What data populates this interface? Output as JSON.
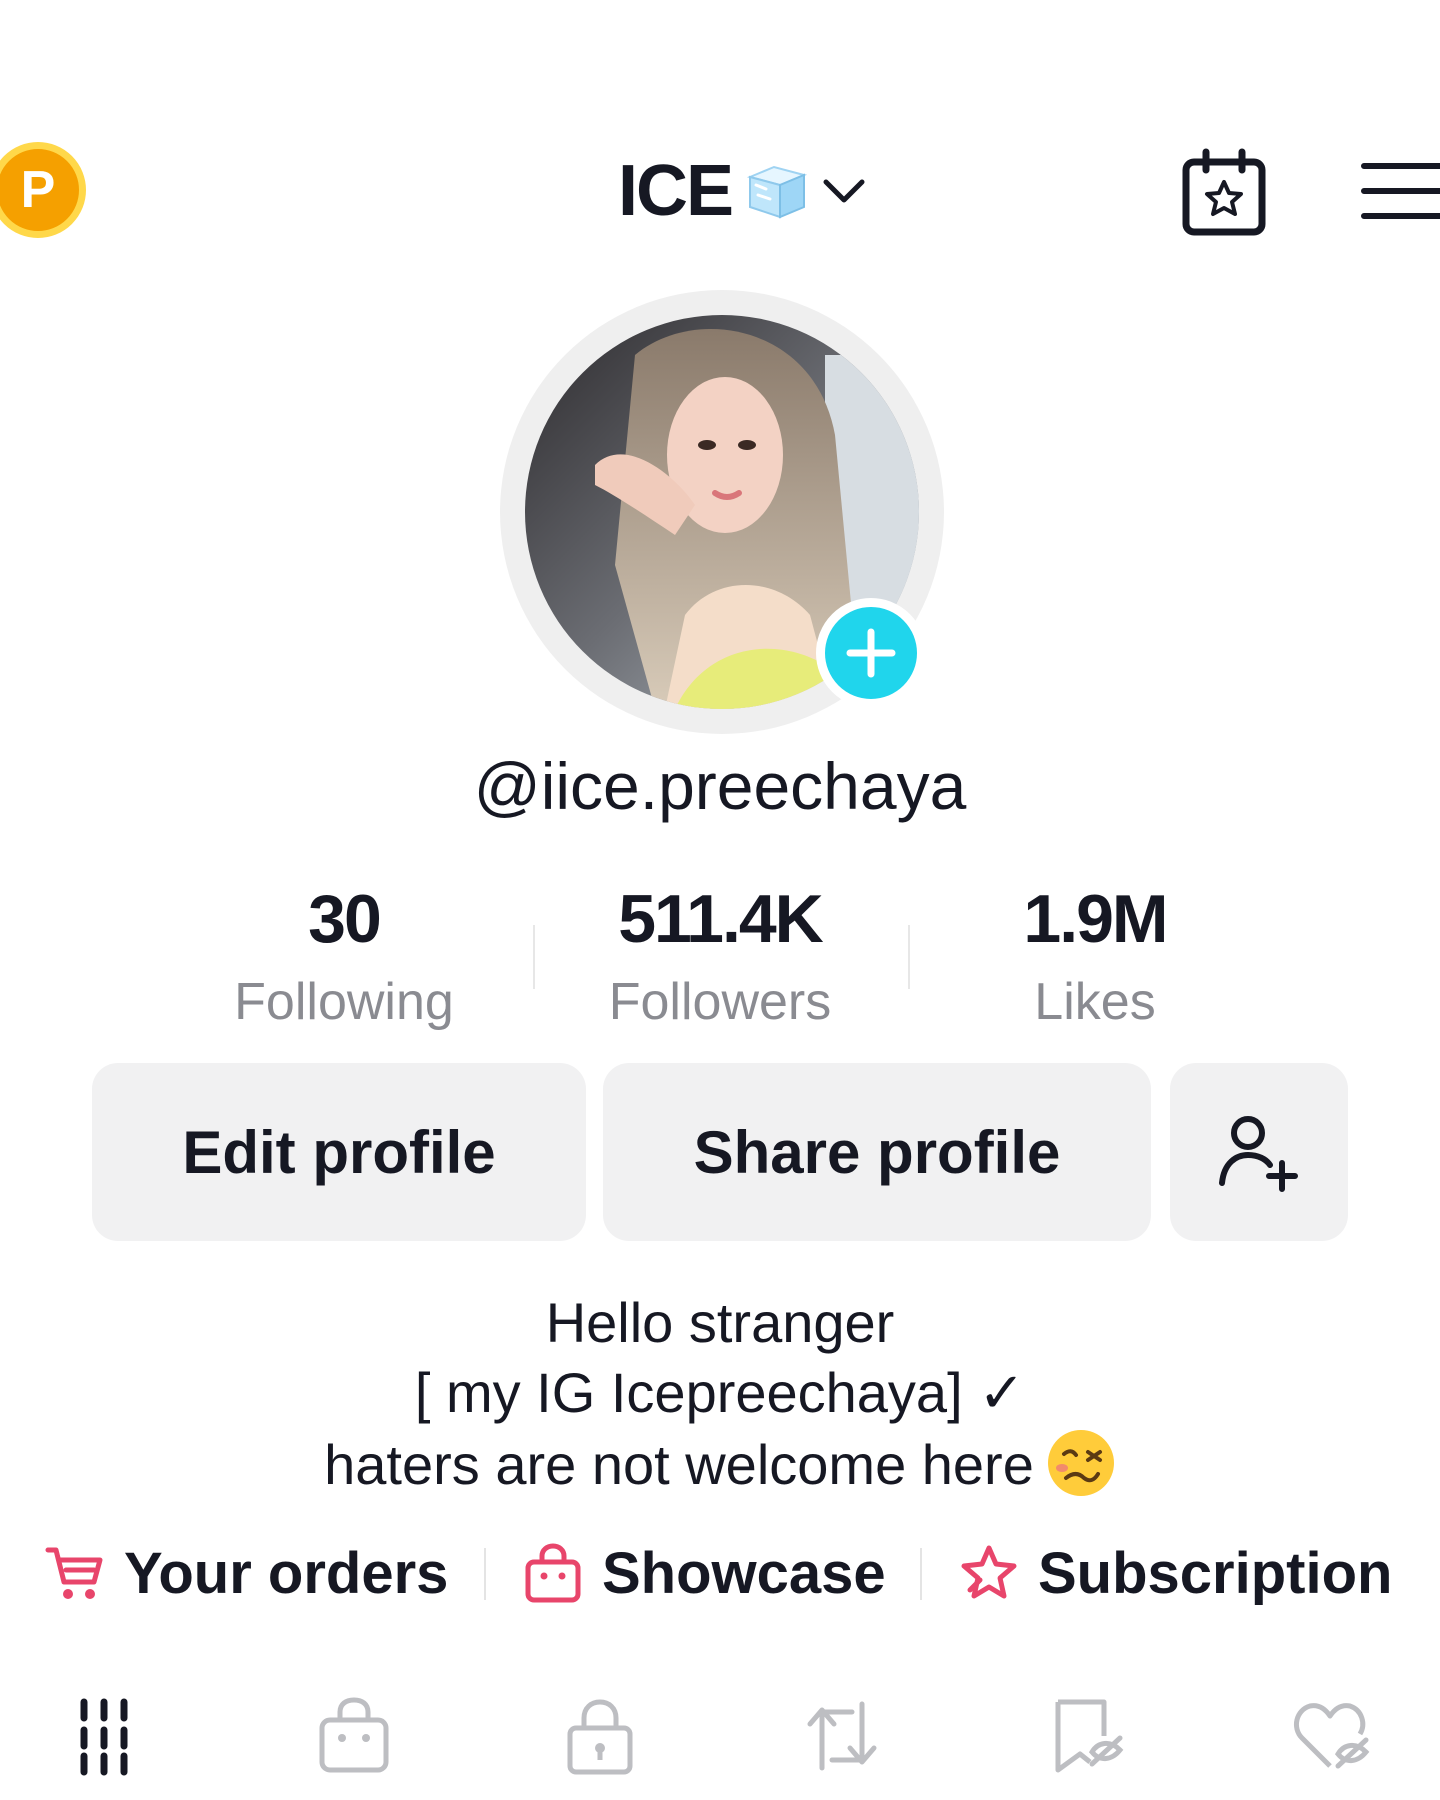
{
  "header": {
    "coin_letter": "P",
    "title": "ICE",
    "title_icon": "ice-cube-emoji",
    "dropdown_icon": "chevron-down-icon",
    "calendar_icon": "calendar-star-icon",
    "menu_icon": "hamburger-menu-icon"
  },
  "profile": {
    "username": "@iice.preechaya",
    "avatar_icon": "profile-photo",
    "add_icon": "plus-icon"
  },
  "stats": [
    {
      "value": "30",
      "label": "Following"
    },
    {
      "value": "511.4K",
      "label": "Followers"
    },
    {
      "value": "1.9M",
      "label": "Likes"
    }
  ],
  "buttons": {
    "edit": "Edit profile",
    "share": "Share profile",
    "add_friend_icon": "add-user-icon"
  },
  "bio": {
    "line1": "Hello stranger",
    "line2": "[ my IG Icepreechaya] ✓",
    "line3": "haters are not welcome here"
  },
  "links": [
    {
      "label": "Your orders",
      "icon": "cart-icon"
    },
    {
      "label": "Showcase",
      "icon": "shopping-bag-icon"
    },
    {
      "label": "Subscription",
      "icon": "subscription-star-icon"
    }
  ],
  "accent_colors": {
    "link_icons": "#e8456b",
    "badge": "#20d5ec",
    "coin": "#f5a000"
  },
  "tabs": [
    "grid-icon",
    "shop-bag-icon",
    "lock-icon",
    "repost-icon",
    "favorites-hidden-icon",
    "liked-hidden-icon"
  ]
}
